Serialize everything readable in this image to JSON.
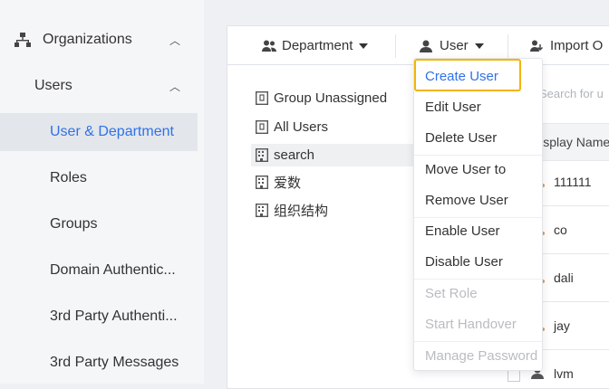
{
  "sidebar": {
    "organizations": "Organizations",
    "users": "Users",
    "items": [
      "User & Department",
      "Roles",
      "Groups",
      "Domain Authentic...",
      "3rd Party Authenti...",
      "3rd Party Messages"
    ]
  },
  "toolbar": {
    "department": "Department",
    "user": "User",
    "import": "Import O"
  },
  "tree": [
    "Group Unassigned",
    "All Users",
    "search",
    "爱数",
    "组织结构"
  ],
  "search": {
    "placeholder": "Search for u"
  },
  "table": {
    "column": "Display Name",
    "rows": [
      "111111",
      "co",
      "dali",
      "jay",
      "lvm"
    ]
  },
  "user_menu": {
    "items": [
      {
        "label": "Create User",
        "disabled": false
      },
      {
        "label": "Edit User",
        "disabled": false
      },
      {
        "label": "Delete User",
        "disabled": false
      },
      {
        "label": "Move User to",
        "disabled": false
      },
      {
        "label": "Remove User",
        "disabled": false
      },
      {
        "label": "Enable User",
        "disabled": false
      },
      {
        "label": "Disable User",
        "disabled": false
      },
      {
        "label": "Set Role",
        "disabled": true
      },
      {
        "label": "Start Handover",
        "disabled": true
      },
      {
        "label": "Manage Password",
        "disabled": true
      }
    ]
  },
  "colors": {
    "accent": "#2f72e8",
    "highlight": "#f4b400"
  }
}
